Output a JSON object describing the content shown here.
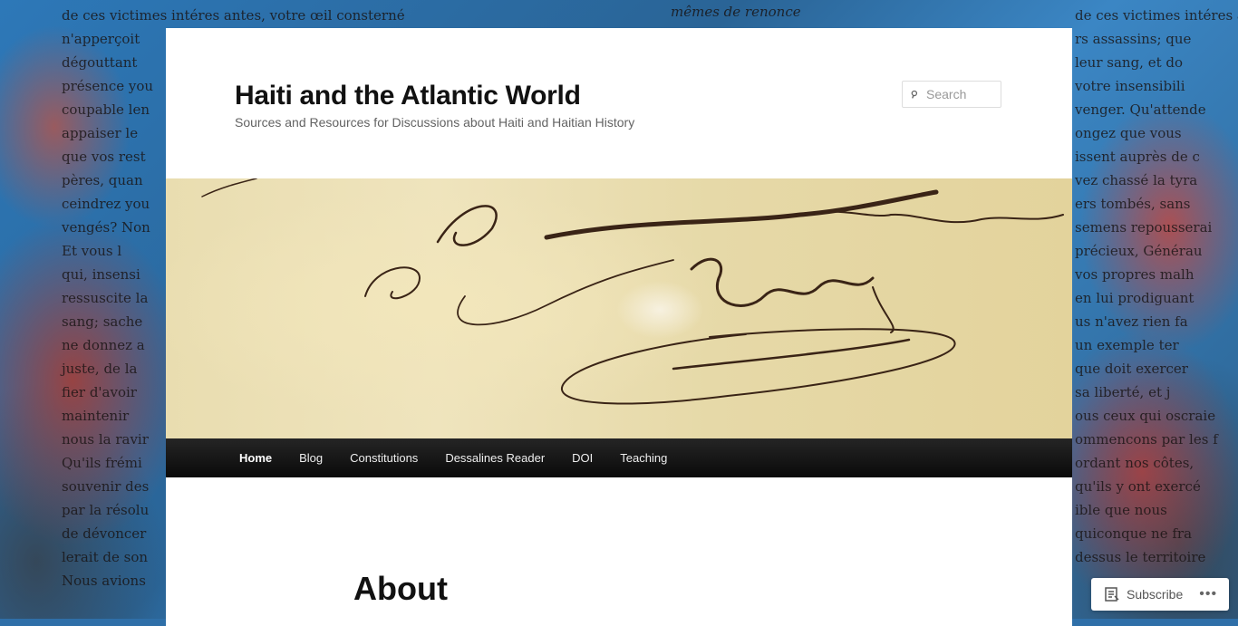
{
  "site": {
    "title": "Haiti and the Atlantic World",
    "description": "Sources and Resources for Discussions about Haiti and Haitian History"
  },
  "search": {
    "placeholder": "Search"
  },
  "nav": {
    "items": [
      "Home",
      "Blog",
      "Constitutions",
      "Dessalines Reader",
      "DOI",
      "Teaching"
    ],
    "current": "Home"
  },
  "page": {
    "title": "About"
  },
  "subscribe": {
    "label": "Subscribe",
    "more": "•••"
  },
  "background": {
    "top_left": "de ces victimes intéres antes, votre œil consterné",
    "top_mid": "mêmes de renonce",
    "top_right": "de ces victimes intéres antes, votre œ",
    "left_lines": [
      "",
      "n'apperçoit",
      "dégouttant",
      "présence you",
      "coupable len",
      "appaiser le",
      "que vos rest",
      "pères, quan",
      "ceindrez you",
      "vengés? Non",
      "Et vous l",
      "qui, insensi",
      "ressuscite la",
      "sang; sache",
      "ne donnez a",
      "juste, de la",
      "fier d'avoir",
      "maintenir",
      "nous la ravir",
      "Qu'ils frémi",
      "souvenir des",
      "par la résolu",
      "de dévoncer",
      "lerait de son",
      "Nous avions"
    ],
    "right_lines": [
      "",
      "rs assassins; que",
      "leur sang, et do",
      "votre insensibili",
      "venger. Qu'attende",
      "ongez que vous",
      "issent auprès de c",
      "vez chassé la tyra",
      "ers tombés, sans",
      "semens repousserai",
      "précieux, Générau",
      "vos propres malh",
      "en lui prodiguant",
      "us n'avez rien fa",
      "un exemple ter",
      "que doit exercer",
      "sa liberté, et j",
      "ous ceux qui oscraie",
      "ommencons par les f",
      "ordant nos côtes,",
      "qu'ils y ont exercé",
      "ible que nous",
      "quiconque ne fra",
      "dessus le territoire",
      ""
    ]
  },
  "colors": {
    "nav_bg": "#1a1a1a",
    "page_bg": "#ffffff",
    "bg_blue": "#2d78b8"
  }
}
